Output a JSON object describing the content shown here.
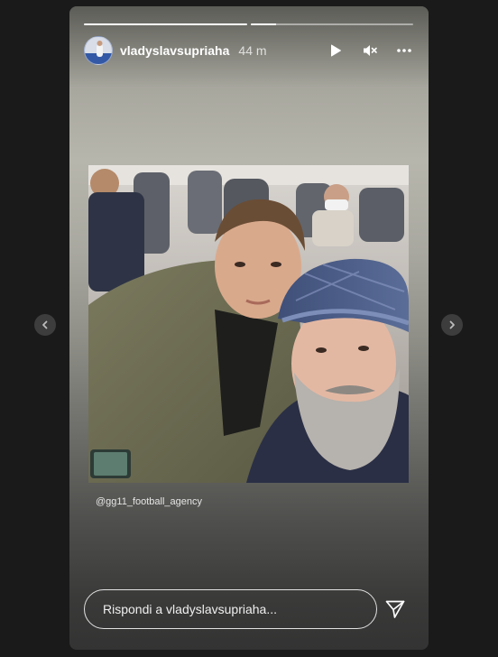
{
  "story": {
    "username": "vladyslavsupriaha",
    "time_ago": "44 m",
    "progress": [
      1.0,
      0.16
    ],
    "mention": "@gg11_football_agency",
    "photo_alt": ""
  },
  "controls": {
    "play_icon": "play-icon",
    "mute_icon": "speaker-muted-icon",
    "more_icon": "more-horizontal-icon"
  },
  "reply": {
    "placeholder": "Rispondi a vladyslavsupriaha...",
    "send_icon": "send-paper-plane-icon"
  },
  "navigation": {
    "prev_icon": "chevron-left-icon",
    "next_icon": "chevron-right-icon"
  }
}
